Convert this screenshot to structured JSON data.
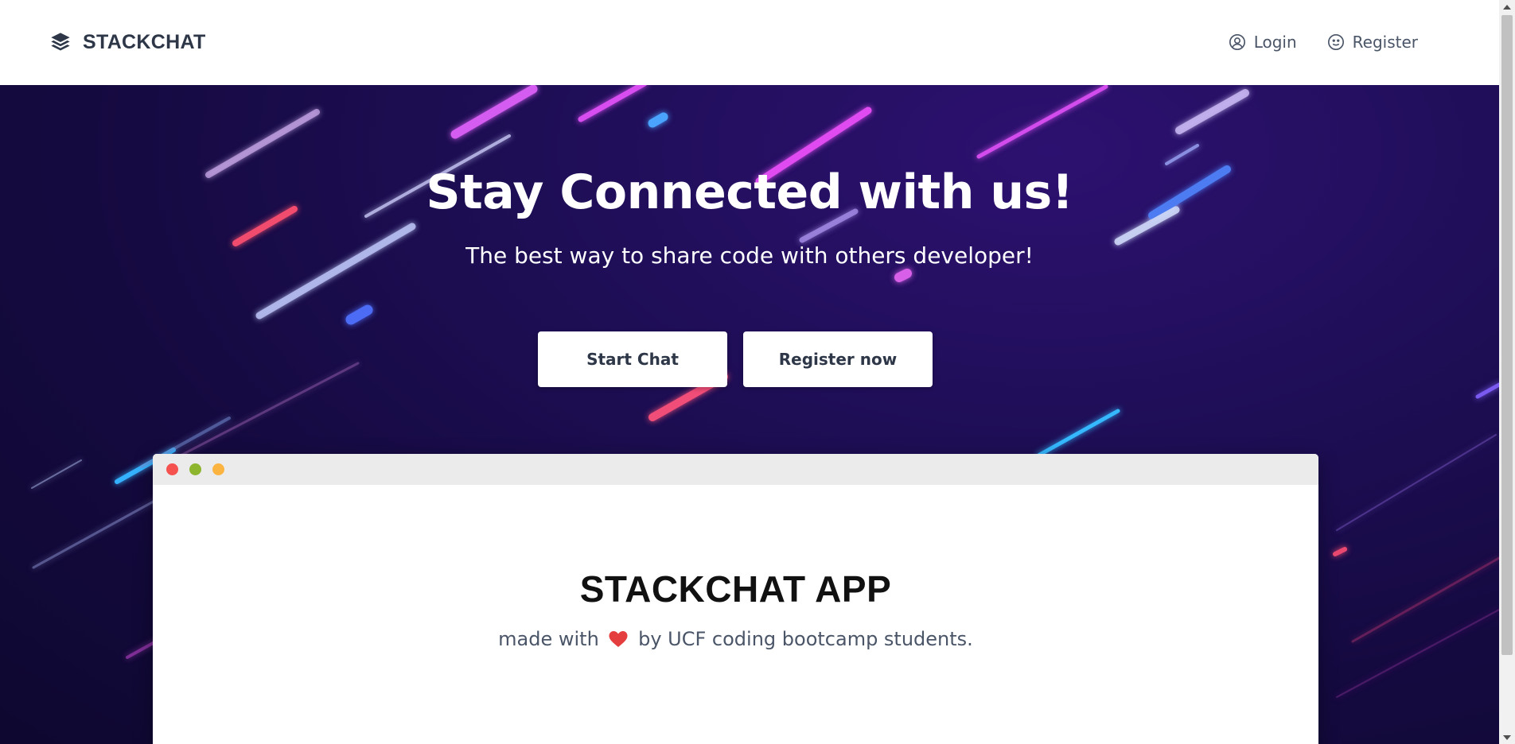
{
  "header": {
    "brand_name": "STACKCHAT",
    "brand_icon": "layers-icon",
    "nav": [
      {
        "label": "Login",
        "icon": "user-circle-icon"
      },
      {
        "label": "Register",
        "icon": "smile-icon"
      }
    ]
  },
  "hero": {
    "title": "Stay Connected with us!",
    "subtitle": "The best way to share code with others developer!",
    "buttons": {
      "start_chat": "Start Chat",
      "register_now": "Register now"
    }
  },
  "window": {
    "title": "STACKCHAT APP",
    "tagline_before": "made with",
    "tagline_after": "by UCF coding bootcamp students.",
    "traffic_lights": [
      "#f4514f",
      "#8db52d",
      "#fbb440"
    ]
  },
  "colors": {
    "brand_text": "#2d3748",
    "nav_text": "#4a5568",
    "hero_background": "#1e0e56",
    "heart": "#e53e3e"
  }
}
